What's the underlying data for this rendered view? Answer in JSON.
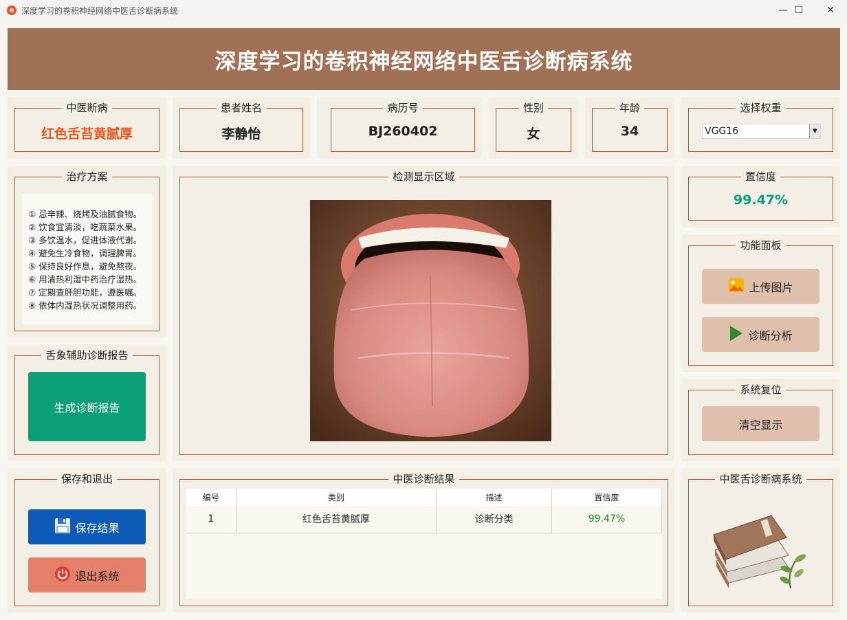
{
  "window": {
    "title": "深度学习的卷积神经网络中医舌诊断病系统",
    "minimize": "—",
    "maximize": "☐",
    "close": "✕"
  },
  "header": {
    "title": "深度学习的卷积神经网络中医舌诊断病系统"
  },
  "info": {
    "diagnosis": {
      "label": "中医断病",
      "value": "红色舌苔黄腻厚"
    },
    "patient_name": {
      "label": "患者姓名",
      "value": "李静怡"
    },
    "record_no": {
      "label": "病历号",
      "value": "BJ260402"
    },
    "gender": {
      "label": "性别",
      "value": "女"
    },
    "age": {
      "label": "年龄",
      "value": "34"
    },
    "weights": {
      "label": "选择权重",
      "selected": "VGG16"
    }
  },
  "treatment": {
    "label": "治疗方案",
    "items": [
      "① 忌辛辣、烧烤及油腻食物。",
      "② 饮食宜清淡，吃蔬菜水果。",
      "③ 多饮温水，促进体液代谢。",
      "④ 避免生冷食物，调理脾胃。",
      "⑤ 保持良好作息，避免熬夜。",
      "⑥ 用清热利湿中药治疗湿热。",
      "⑦ 定期查肝胆功能，遵医嘱。",
      "⑧ 依体内湿热状况调整用药。"
    ]
  },
  "report": {
    "label": "舌象辅助诊断报告",
    "button": "生成诊断报告"
  },
  "save_exit": {
    "label": "保存和退出",
    "save": "保存结果",
    "exit": "退出系统"
  },
  "detection": {
    "label": "检测显示区域"
  },
  "confidence": {
    "label": "置信度",
    "value": "99.47%"
  },
  "functions": {
    "label": "功能面板",
    "upload": "上传图片",
    "analyze": "诊断分析"
  },
  "reset": {
    "label": "系统复位",
    "clear": "清空显示"
  },
  "results": {
    "label": "中医诊断结果",
    "columns": [
      "编号",
      "类别",
      "描述",
      "置信度"
    ],
    "rows": [
      {
        "id": "1",
        "category": "红色舌苔黄腻厚",
        "desc": "诊断分类",
        "confidence": "99.47%"
      }
    ]
  },
  "logo_panel": {
    "label": "中医舌诊断病系统"
  },
  "colors": {
    "header_bg": "#a07154",
    "accent_orange": "#e65a1e",
    "green": "#0aa077",
    "save_blue": "#0d5bb8",
    "exit_salmon": "#e4806a",
    "btn_tan": "#dfc0ac"
  }
}
